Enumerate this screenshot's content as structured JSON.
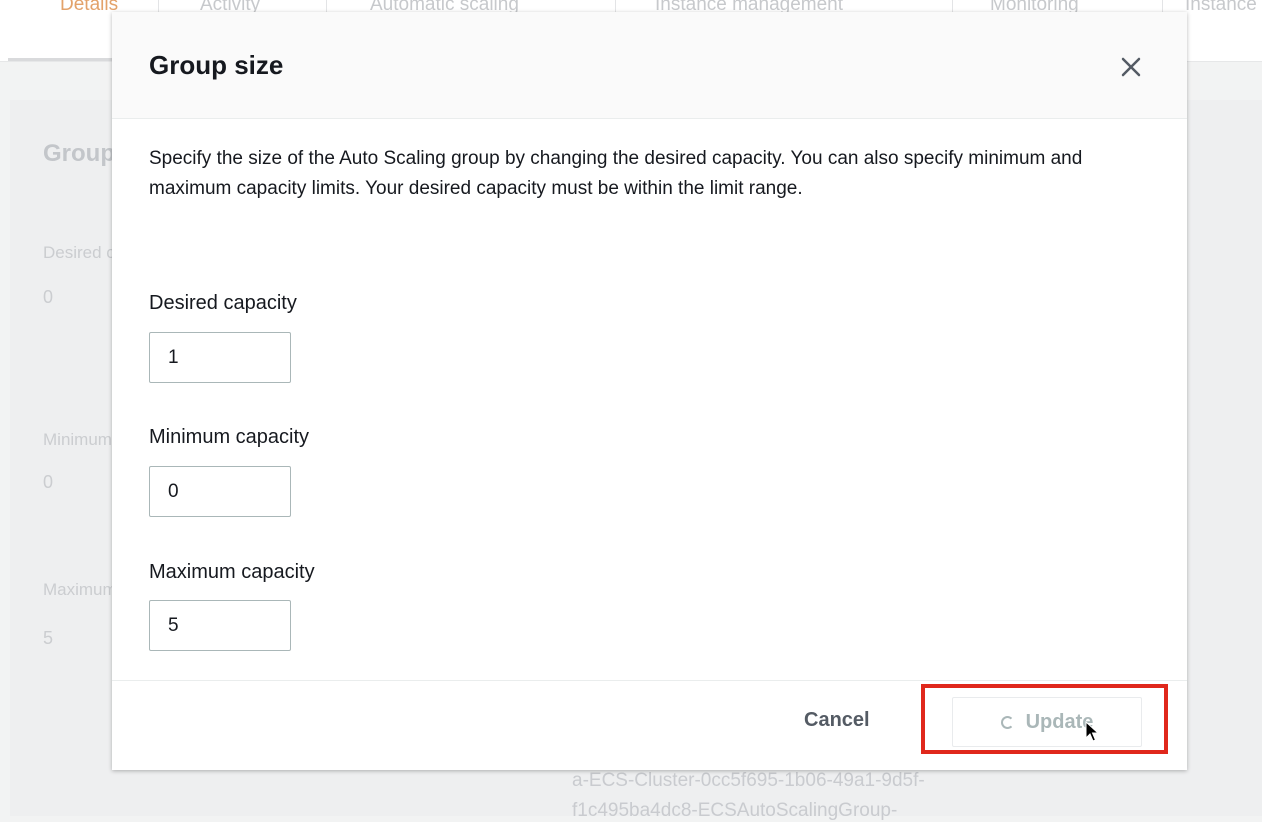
{
  "background": {
    "tabs": [
      {
        "label": "Details",
        "active": true
      },
      {
        "label": "Activity"
      },
      {
        "label": "Automatic scaling"
      },
      {
        "label": "Instance management"
      },
      {
        "label": "Monitoring"
      },
      {
        "label": "Instance refresh"
      }
    ],
    "section_heading": "Group details",
    "fields": [
      {
        "label": "Desired capacity",
        "value": "0"
      },
      {
        "label": "Minimum capacity",
        "value": "0"
      },
      {
        "label": "Maximum capacity",
        "value": "5"
      }
    ],
    "group_name_line1": "a-ECS-Cluster-0cc5f695-1b06-49a1-9d5f-",
    "group_name_line2": "f1c495ba4dc8-ECSAutoScalingGroup-"
  },
  "modal": {
    "title": "Group size",
    "description": "Specify the size of the Auto Scaling group by changing the desired capacity. You can also specify minimum and maximum capacity limits. Your desired capacity must be within the limit range.",
    "fields": {
      "desired": {
        "label": "Desired capacity",
        "value": "1"
      },
      "minimum": {
        "label": "Minimum capacity",
        "value": "0"
      },
      "maximum": {
        "label": "Maximum capacity",
        "value": "5"
      }
    },
    "cancel_label": "Cancel",
    "update_label": "Update"
  },
  "colors": {
    "highlight": "#e0281c",
    "tab_active": "#e3a26a",
    "disabled_text": "#aab7b8"
  },
  "icons": {
    "close": "close-icon",
    "spinner": "spinner-icon",
    "cursor": "mouse-pointer-icon"
  }
}
